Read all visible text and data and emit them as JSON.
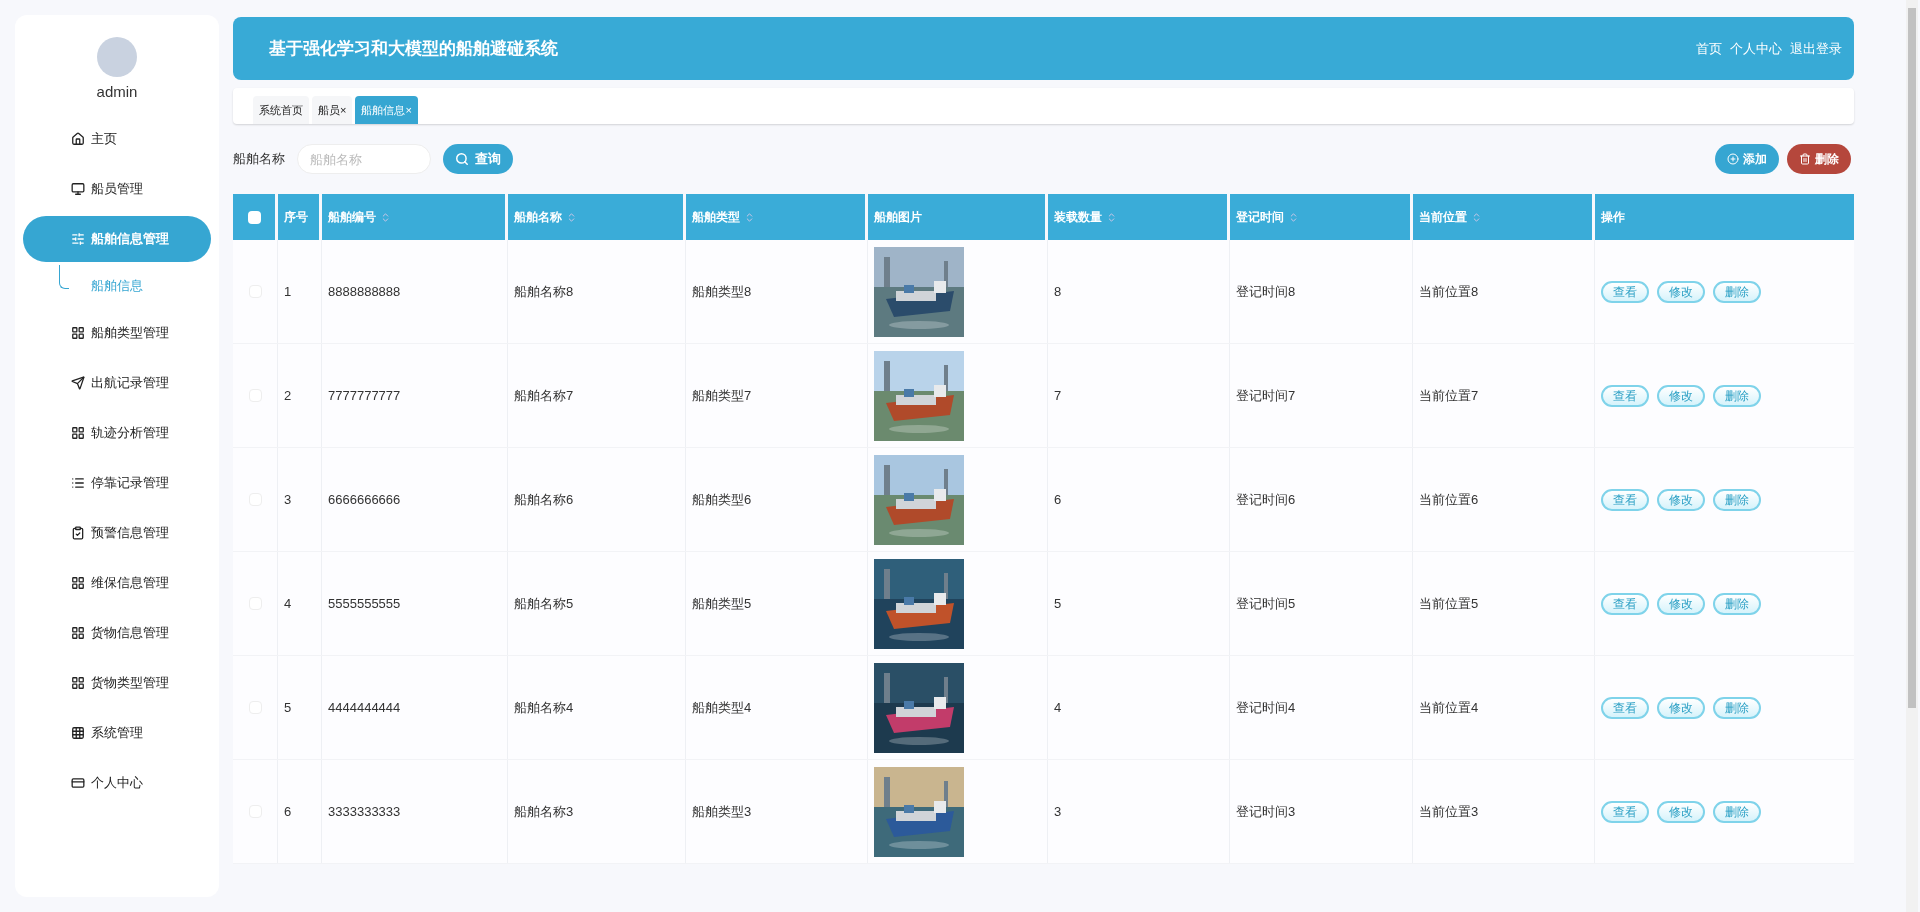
{
  "sidebar": {
    "username": "admin",
    "items": [
      {
        "label": "主页",
        "selected": false
      },
      {
        "label": "船员管理",
        "selected": false
      },
      {
        "label": "船舶信息管理",
        "selected": true,
        "children": [
          {
            "label": "船舶信息",
            "selected": true
          }
        ]
      },
      {
        "label": "船舶类型管理",
        "selected": false
      },
      {
        "label": "出航记录管理",
        "selected": false
      },
      {
        "label": "轨迹分析管理",
        "selected": false
      },
      {
        "label": "停靠记录管理",
        "selected": false
      },
      {
        "label": "预警信息管理",
        "selected": false
      },
      {
        "label": "维保信息管理",
        "selected": false
      },
      {
        "label": "货物信息管理",
        "selected": false
      },
      {
        "label": "货物类型管理",
        "selected": false
      },
      {
        "label": "系统管理",
        "selected": false
      },
      {
        "label": "个人中心",
        "selected": false
      }
    ]
  },
  "header": {
    "title": "基于强化学习和大模型的船舶避碰系统",
    "links": [
      "首页",
      "个人中心",
      "退出登录"
    ]
  },
  "tabs": [
    {
      "label": "系统首页",
      "closable": false,
      "selected": false
    },
    {
      "label": "船员",
      "closable": true,
      "selected": false
    },
    {
      "label": "船舶信息",
      "closable": true,
      "selected": true
    }
  ],
  "close_glyph": "×",
  "search": {
    "label": "船舶名称",
    "placeholder": "船舶名称",
    "button": "查询"
  },
  "actions": [
    {
      "label": "添加",
      "kind": "add"
    },
    {
      "label": "删除",
      "kind": "delete"
    }
  ],
  "table": {
    "columns": [
      {
        "label": "序号",
        "sortable": false
      },
      {
        "label": "船舶编号",
        "sortable": true
      },
      {
        "label": "船舶名称",
        "sortable": true
      },
      {
        "label": "船舶类型",
        "sortable": true
      },
      {
        "label": "船舶图片",
        "sortable": false
      },
      {
        "label": "装载数量",
        "sortable": true
      },
      {
        "label": "登记时间",
        "sortable": true
      },
      {
        "label": "当前位置",
        "sortable": true
      },
      {
        "label": "操作",
        "sortable": false
      }
    ],
    "all_checked": false,
    "rows": [
      {
        "index": "1",
        "number": "8888888888",
        "name": "船舶名称8",
        "type": "船舶类型8",
        "count": "8",
        "time": "登记时间8",
        "location": "当前位置8",
        "checked": false,
        "actions": [
          "查看",
          "修改",
          "删除"
        ]
      },
      {
        "index": "2",
        "number": "7777777777",
        "name": "船舶名称7",
        "type": "船舶类型7",
        "count": "7",
        "time": "登记时间7",
        "location": "当前位置7",
        "checked": false,
        "actions": [
          "查看",
          "修改",
          "删除"
        ]
      },
      {
        "index": "3",
        "number": "6666666666",
        "name": "船舶名称6",
        "type": "船舶类型6",
        "count": "6",
        "time": "登记时间6",
        "location": "当前位置6",
        "checked": false,
        "actions": [
          "查看",
          "修改",
          "删除"
        ]
      },
      {
        "index": "4",
        "number": "5555555555",
        "name": "船舶名称5",
        "type": "船舶类型5",
        "count": "5",
        "time": "登记时间5",
        "location": "当前位置5",
        "checked": false,
        "actions": [
          "查看",
          "修改",
          "删除"
        ]
      },
      {
        "index": "5",
        "number": "4444444444",
        "name": "船舶名称4",
        "type": "船舶类型4",
        "count": "4",
        "time": "登记时间4",
        "location": "当前位置4",
        "checked": false,
        "actions": [
          "查看",
          "修改",
          "删除"
        ]
      },
      {
        "index": "6",
        "number": "3333333333",
        "name": "船舶名称3",
        "type": "船舶类型3",
        "count": "3",
        "time": "登记时间3",
        "location": "当前位置3",
        "checked": false,
        "actions": [
          "查看",
          "修改",
          "删除"
        ]
      }
    ]
  }
}
